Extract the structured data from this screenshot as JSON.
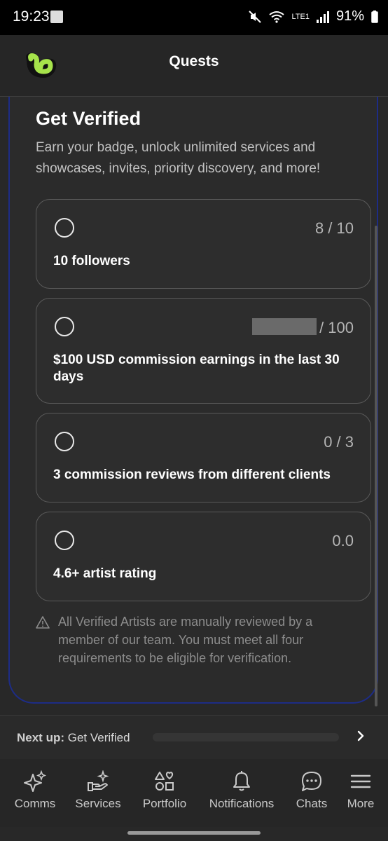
{
  "status_bar": {
    "time": "19:23",
    "battery": "91%",
    "network": "LTE1"
  },
  "header": {
    "title": "Quests"
  },
  "quest": {
    "title": "Get Verified",
    "description": "Earn your badge, unlock unlimited services and showcases, invites, priority discovery, and more!",
    "requirements": [
      {
        "progress": "8 / 10",
        "label": "10 followers"
      },
      {
        "progress": "/ 100",
        "label": "$100 USD commission earnings in the last 30 days"
      },
      {
        "progress": "0 / 3",
        "label": "3 commission reviews from different clients"
      },
      {
        "progress": "0.0",
        "label": "4.6+ artist rating"
      }
    ],
    "notice": "All Verified Artists are manually reviewed by a member of our team. You must meet all four requirements to be eligible for verification."
  },
  "next_up": {
    "prefix": "Next up:",
    "quest": "Get Verified"
  },
  "nav": {
    "items": [
      {
        "label": "Comms",
        "icon": "sparkles-icon"
      },
      {
        "label": "Services",
        "icon": "hand-sparkle-icon"
      },
      {
        "label": "Portfolio",
        "icon": "shapes-icon"
      },
      {
        "label": "Notifications",
        "icon": "bell-icon"
      },
      {
        "label": "Chats",
        "icon": "chat-bubble-icon"
      },
      {
        "label": "More",
        "icon": "menu-icon"
      }
    ]
  },
  "colors": {
    "accent_logo": "#a6e34b",
    "card_border": "#1d2c86",
    "background": "#282828"
  }
}
